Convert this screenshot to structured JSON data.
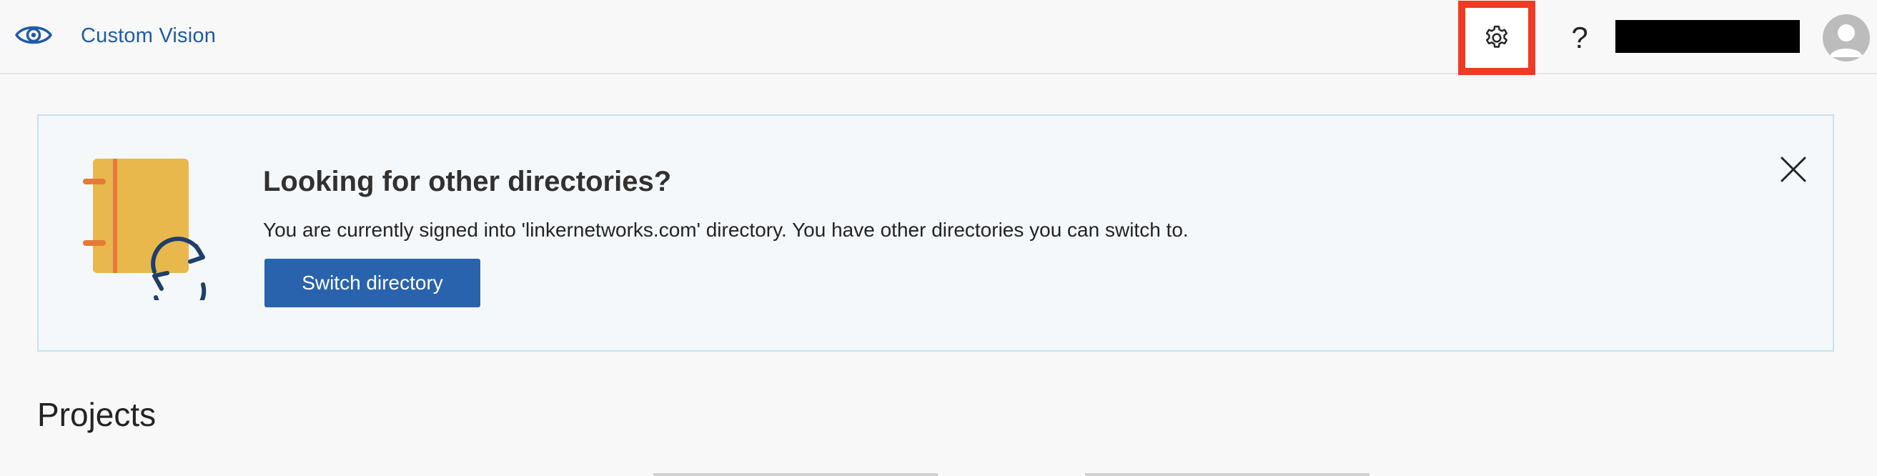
{
  "header": {
    "app_name": "Custom Vision",
    "logo_icon": "eye-icon",
    "settings_icon": "gear-icon",
    "help_label": "?",
    "highlight_color": "#ef3b23"
  },
  "banner": {
    "title": "Looking for other directories?",
    "description": "You are currently signed into 'linkernetworks.com' directory. You have other directories you can switch to.",
    "button_label": "Switch directory",
    "close_icon": "close-icon",
    "illustration": "notebook-sync-icon"
  },
  "projects": {
    "title": "Projects"
  },
  "colors": {
    "brand": "#1e5ba8",
    "primary_button": "#2a63ad",
    "banner_background": "#f4f8fb",
    "banner_border": "#c6e2f3"
  }
}
